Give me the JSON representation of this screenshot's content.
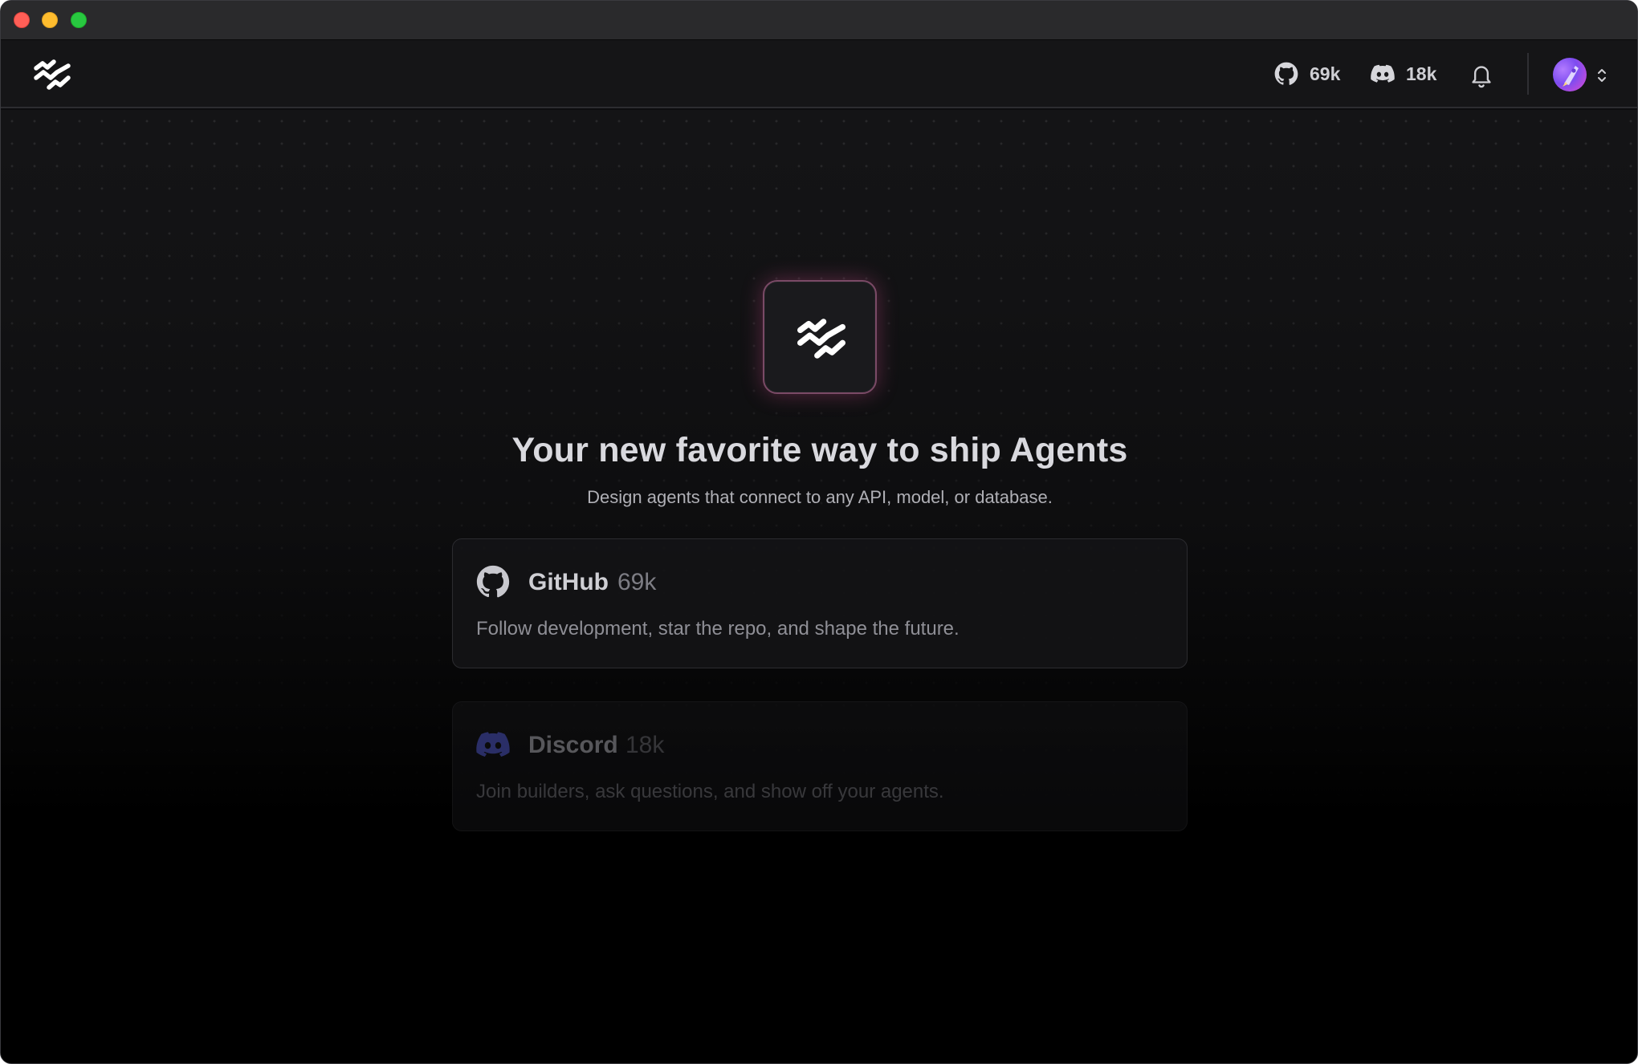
{
  "colors": {
    "window_bg": "#0d0d0f",
    "header_bg": "#151517",
    "accent_glow": "#dc5096",
    "discord_blurple": "#5865F2"
  },
  "header": {
    "logo_icon": "langflow-wave-logo-icon",
    "github_count": "69k",
    "discord_count": "18k",
    "notifications_icon": "bell-icon",
    "account_chevron_icon": "chevron-up-down-icon"
  },
  "hero": {
    "icon": "langflow-wave-logo-icon",
    "title": "Your new favorite way to ship Agents",
    "subtitle": "Design agents that connect to any API, model, or database."
  },
  "cards": {
    "github": {
      "icon": "github-icon",
      "name": "GitHub",
      "count": "69k",
      "description": "Follow development, star the repo, and shape the future."
    },
    "discord": {
      "icon": "discord-icon",
      "name": "Discord",
      "count": "18k",
      "description": "Join builders, ask questions, and show off your agents."
    }
  }
}
